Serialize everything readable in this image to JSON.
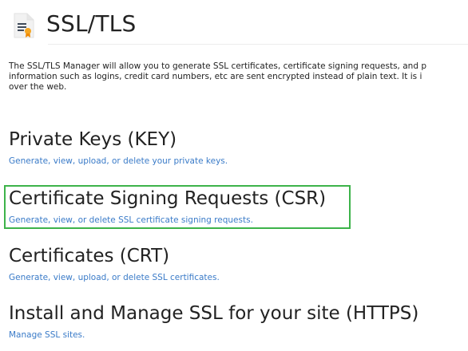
{
  "header": {
    "title": "SSL/TLS",
    "icon": "ssl-certificate-icon"
  },
  "intro": {
    "line1": "The SSL/TLS Manager will allow you to generate SSL certificates, certificate signing requests, and p",
    "line2": "information such as logins, credit card numbers, etc are sent encrypted instead of plain text. It is i",
    "line3": "over the web."
  },
  "sections": [
    {
      "title": "Private Keys (KEY)",
      "link": "Generate, view, upload, or delete your private keys."
    },
    {
      "title": "Certificate Signing Requests (CSR)",
      "link": "Generate, view, or delete SSL certificate signing requests."
    },
    {
      "title": "Certificates (CRT)",
      "link": "Generate, view, upload, or delete SSL certificates."
    },
    {
      "title": "Install and Manage SSL for your site (HTTPS)",
      "link": "Manage SSL sites."
    }
  ],
  "colors": {
    "link": "#3a7bc8",
    "highlight": "#3db34a"
  }
}
